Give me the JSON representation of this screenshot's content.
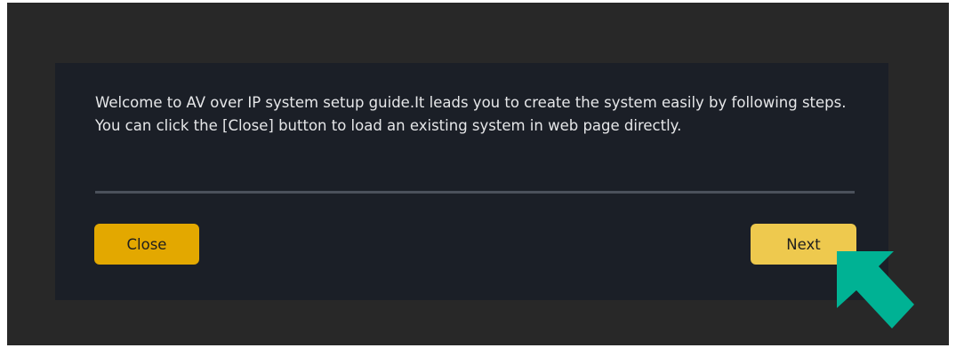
{
  "dialog": {
    "message_line1": "Welcome to AV over IP system setup guide.It leads you to create the system easily by following steps.",
    "message_line2": "You can click the [Close] button to load an existing system in web page directly.",
    "close_label": "Close",
    "next_label": "Next"
  },
  "annotation": {
    "pointer_icon": "arrow-up-left-icon",
    "pointer_color": "#00b294"
  },
  "colors": {
    "page_background": "#282828",
    "dialog_background": "#1b1f27",
    "close_button": "#e3a800",
    "next_button": "#eec94e",
    "divider": "#4b515b"
  }
}
